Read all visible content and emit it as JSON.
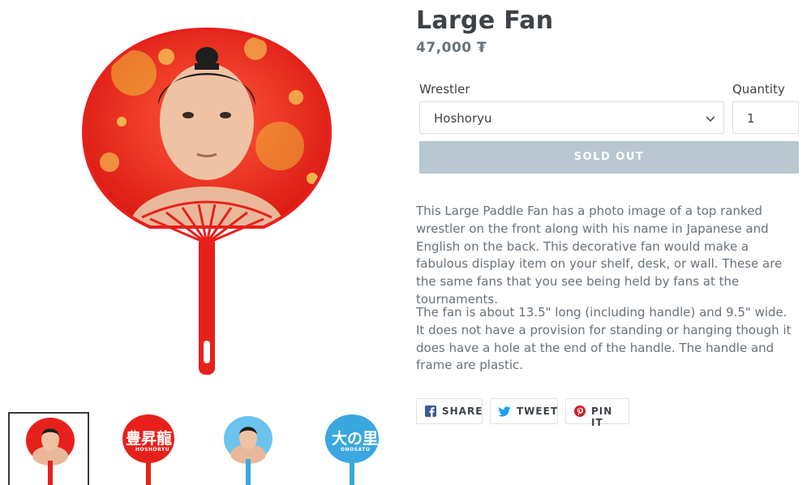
{
  "product": {
    "title": "Large Fan",
    "price": "47,000 ₮",
    "wrestler_label": "Wrestler",
    "wrestler_value": "Hoshoryu",
    "quantity_label": "Quantity",
    "quantity_value": "1",
    "sold_out_label": "SOLD OUT",
    "description": [
      "This Large Paddle Fan has a photo image of a top ranked wrestler on the front along with his name in Japanese and English on the back. This decorative fan would make a fabulous display item on your shelf, desk, or wall.  These are the same fans that you see being held by fans at the tournaments.",
      "The fan is about 13.5\" long (including handle) and 9.5\" wide.  It does not have a provision for standing or hanging though it does have a hole at the end of the handle.  The handle and frame are plastic."
    ]
  },
  "share": {
    "facebook_label": "SHARE",
    "twitter_label": "TWEET",
    "pinterest_label": "PIN IT"
  },
  "thumbnails": [
    {
      "kind": "red-photo",
      "selected": true
    },
    {
      "kind": "red-text",
      "text": "豊昇龍",
      "sub": "HOSHORYU"
    },
    {
      "kind": "blue-photo"
    },
    {
      "kind": "blue-text",
      "text": "大の里",
      "sub": "ONOSATO"
    }
  ],
  "colors": {
    "fan_red": "#e8201c",
    "fan_blue": "#3aa7e0",
    "sold_out_bg": "#b8c7d0",
    "facebook": "#3b5998",
    "twitter": "#1da1f2",
    "pinterest": "#cb2027"
  }
}
